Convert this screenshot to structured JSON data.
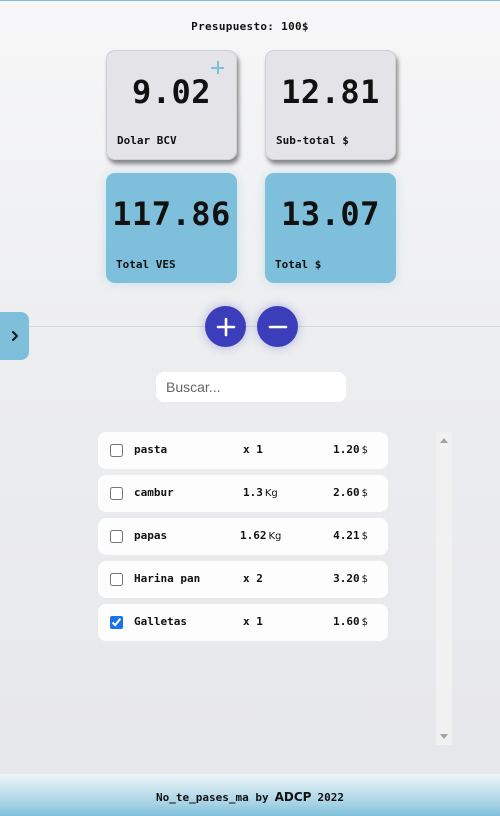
{
  "header": {
    "budget": "Presupuesto: 100$"
  },
  "cards": {
    "dolar_bcv": {
      "value": "9.02",
      "label": "Dolar BCV"
    },
    "subtotal": {
      "value": "12.81",
      "label": "Sub-total $"
    },
    "total_ves": {
      "value": "117.86",
      "label": "Total VES"
    },
    "total_usd": {
      "value": "13.07",
      "label": "Total $"
    }
  },
  "search": {
    "placeholder": "Buscar...",
    "value": ""
  },
  "items": [
    {
      "name": "pasta",
      "qty": "x 1",
      "unit": "",
      "price": "1.20",
      "currency": "$",
      "checked": false
    },
    {
      "name": "cambur",
      "qty": "1.3",
      "unit": "Kg",
      "price": "2.60",
      "currency": "$",
      "checked": false
    },
    {
      "name": "papas",
      "qty": "1.62",
      "unit": "Kg",
      "price": "4.21",
      "currency": "$",
      "checked": false
    },
    {
      "name": "Harina pan",
      "qty": "x 2",
      "unit": "",
      "price": "3.20",
      "currency": "$",
      "checked": false
    },
    {
      "name": "Galletas",
      "qty": "x 1",
      "unit": "",
      "price": "1.60",
      "currency": "$",
      "checked": true
    }
  ],
  "footer": {
    "prefix": "No_te_pases_ma by",
    "brand": "ADCP",
    "year": "2022"
  },
  "icons": {
    "add": "plus-icon",
    "remove": "minus-icon",
    "expand": "chevron-right-icon"
  },
  "colors": {
    "accent_blue": "#7ec0db",
    "button_indigo": "#3b3dbb",
    "checkbox_blue": "#1a73e8"
  }
}
